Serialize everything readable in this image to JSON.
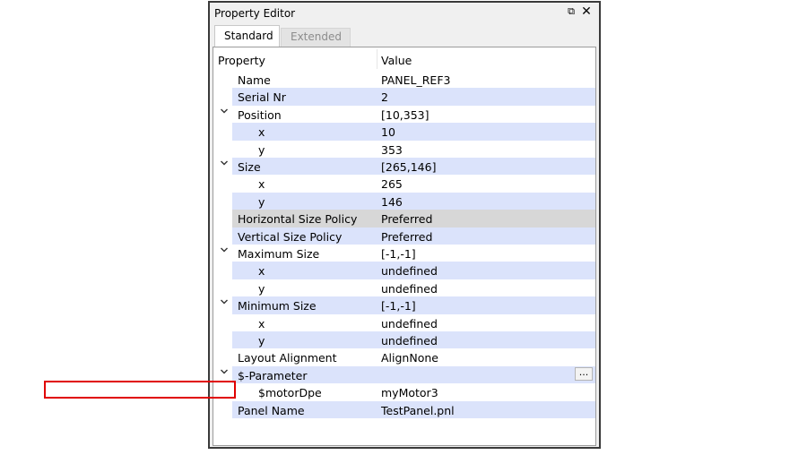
{
  "window": {
    "title": "Property Editor",
    "float_icon": "float-icon",
    "close_icon": "close-icon"
  },
  "tabs": [
    {
      "label": "Standard",
      "active": true
    },
    {
      "label": "Extended",
      "active": false
    }
  ],
  "table": {
    "headers": {
      "property": "Property",
      "value": "Value"
    },
    "rows": [
      {
        "property": "Name",
        "value": "PANEL_REF3",
        "indent": 1,
        "expander": false,
        "style": "normal"
      },
      {
        "property": "Serial Nr",
        "value": "2",
        "indent": 1,
        "expander": false,
        "style": "alt"
      },
      {
        "property": "Position",
        "value": "[10,353]",
        "indent": 1,
        "expander": true,
        "style": "normal"
      },
      {
        "property": "x",
        "value": "10",
        "indent": 2,
        "expander": false,
        "style": "alt"
      },
      {
        "property": "y",
        "value": "353",
        "indent": 2,
        "expander": false,
        "style": "normal"
      },
      {
        "property": "Size",
        "value": "[265,146]",
        "indent": 1,
        "expander": true,
        "style": "alt"
      },
      {
        "property": "x",
        "value": "265",
        "indent": 2,
        "expander": false,
        "style": "normal"
      },
      {
        "property": "y",
        "value": "146",
        "indent": 2,
        "expander": false,
        "style": "alt"
      },
      {
        "property": "Horizontal Size Policy",
        "value": "Preferred",
        "indent": 1,
        "expander": false,
        "style": "selected"
      },
      {
        "property": "Vertical Size Policy",
        "value": "Preferred",
        "indent": 1,
        "expander": false,
        "style": "alt"
      },
      {
        "property": "Maximum Size",
        "value": "[-1,-1]",
        "indent": 1,
        "expander": true,
        "style": "normal"
      },
      {
        "property": "x",
        "value": "undefined",
        "indent": 2,
        "expander": false,
        "style": "alt"
      },
      {
        "property": "y",
        "value": "undefined",
        "indent": 2,
        "expander": false,
        "style": "normal"
      },
      {
        "property": "Minimum Size",
        "value": "[-1,-1]",
        "indent": 1,
        "expander": true,
        "style": "alt"
      },
      {
        "property": "x",
        "value": "undefined",
        "indent": 2,
        "expander": false,
        "style": "normal"
      },
      {
        "property": "y",
        "value": "undefined",
        "indent": 2,
        "expander": false,
        "style": "alt"
      },
      {
        "property": "Layout Alignment",
        "value": "AlignNone",
        "indent": 1,
        "expander": false,
        "style": "normal"
      },
      {
        "property": "$-Parameter",
        "value": "",
        "indent": 1,
        "expander": true,
        "style": "alt",
        "button": "..."
      },
      {
        "property": "$motorDpe",
        "value": "myMotor3",
        "indent": 2,
        "expander": false,
        "style": "normal",
        "highlighted": true
      },
      {
        "property": "Panel Name",
        "value": "TestPanel.pnl",
        "indent": 1,
        "expander": false,
        "style": "alt"
      }
    ]
  },
  "colors": {
    "alt_row": "#dbe3fb",
    "selected_row": "#d7d7d7",
    "highlight_border": "#e00000"
  }
}
